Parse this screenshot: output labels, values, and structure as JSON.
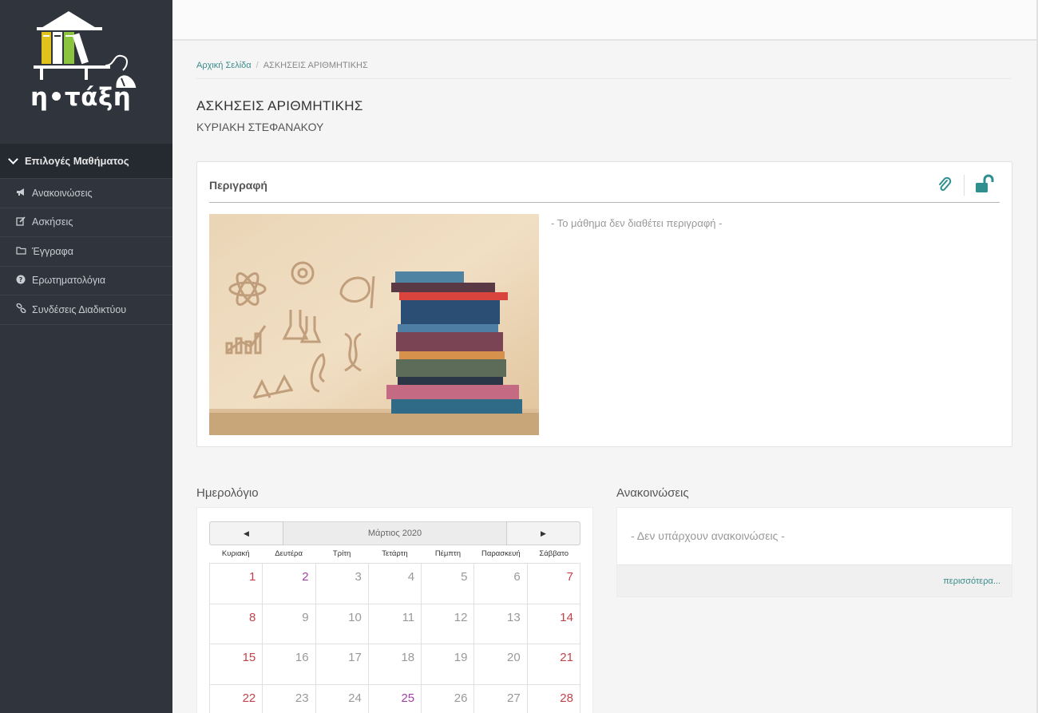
{
  "logo": {
    "text": "η•τάξη"
  },
  "sidebar": {
    "header": "Επιλογές Μαθήματος",
    "items": [
      {
        "label": "Ανακοινώσεις",
        "icon": "megaphone-icon"
      },
      {
        "label": "Ασκήσεις",
        "icon": "edit-icon"
      },
      {
        "label": "Έγγραφα",
        "icon": "folder-icon"
      },
      {
        "label": "Ερωτηματολόγια",
        "icon": "question-circle-icon"
      },
      {
        "label": "Συνδέσεις Διαδικτύου",
        "icon": "link-icon"
      }
    ]
  },
  "breadcrumb": {
    "home": "Αρχική Σελίδα",
    "sep": "/",
    "current": "ΑΣΚΗΣΕΙΣ ΑΡΙΘΜΗΤΙΚΗΣ"
  },
  "course": {
    "title": "ΑΣΚΗΣΕΙΣ ΑΡΙΘΜΗΤΙΚΗΣ",
    "teacher": "ΚΥΡΙΑΚΗ ΣΤΕΦΑΝΑΚΟΥ"
  },
  "description": {
    "title": "Περιγραφή",
    "empty_text": "- Το μάθημα δεν διαθέτει περιγραφή -",
    "accent": "#2f8f8f"
  },
  "calendar": {
    "section_title": "Ημερολόγιο",
    "month": "Μάρτιος 2020",
    "prev": "◀",
    "next": "▶",
    "weekdays": [
      "Κυριακή",
      "Δευτέρα",
      "Τρίτη",
      "Τετάρτη",
      "Πέμπτη",
      "Παρασκευή",
      "Σάββατο"
    ],
    "weeks": [
      [
        "1",
        "2",
        "3",
        "4",
        "5",
        "6",
        "7"
      ],
      [
        "8",
        "9",
        "10",
        "11",
        "12",
        "13",
        "14"
      ],
      [
        "15",
        "16",
        "17",
        "18",
        "19",
        "20",
        "21"
      ],
      [
        "22",
        "23",
        "24",
        "25",
        "26",
        "27",
        "28"
      ]
    ],
    "event_days": [
      "2",
      "25"
    ],
    "weekend_color": "#c2424a",
    "event_color": "#a33fa8"
  },
  "announcements": {
    "section_title": "Ανακοινώσεις",
    "empty_text": "- Δεν υπάρχουν ανακοινώσεις -",
    "more": "περισσότερα..."
  }
}
